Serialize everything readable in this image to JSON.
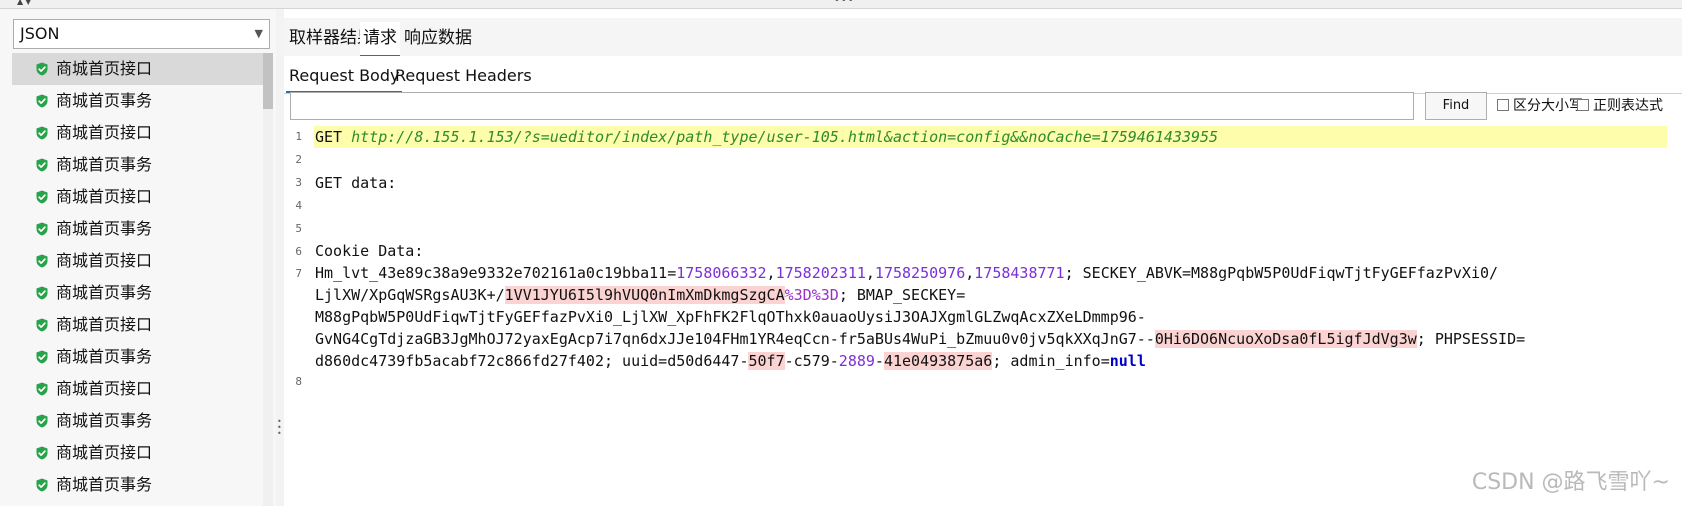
{
  "renderer": {
    "selected": "JSON"
  },
  "sample_list": {
    "items": [
      {
        "label": "商城首页接口",
        "status": "success"
      },
      {
        "label": "商城首页事务",
        "status": "success"
      },
      {
        "label": "商城首页接口",
        "status": "success"
      },
      {
        "label": "商城首页事务",
        "status": "success"
      },
      {
        "label": "商城首页接口",
        "status": "success"
      },
      {
        "label": "商城首页事务",
        "status": "success"
      },
      {
        "label": "商城首页接口",
        "status": "success"
      },
      {
        "label": "商城首页事务",
        "status": "success"
      },
      {
        "label": "商城首页接口",
        "status": "success"
      },
      {
        "label": "商城首页事务",
        "status": "success"
      },
      {
        "label": "商城首页接口",
        "status": "success"
      },
      {
        "label": "商城首页事务",
        "status": "success"
      },
      {
        "label": "商城首页接口",
        "status": "success"
      },
      {
        "label": "商城首页事务",
        "status": "success"
      }
    ]
  },
  "main_tabs": [
    {
      "label": "取样器结果",
      "active": false
    },
    {
      "label": "请求",
      "active": true
    },
    {
      "label": "响应数据",
      "active": false
    }
  ],
  "sub_tabs": [
    {
      "label": "Request Body",
      "active": true
    },
    {
      "label": "Request Headers",
      "active": false
    }
  ],
  "search": {
    "value": "",
    "find_label": "Find",
    "case_sensitive_label": "区分大小写",
    "regex_label": "正则表达式"
  },
  "editor": {
    "line_numbers": [
      "1",
      "2",
      "3",
      "4",
      "5",
      "6",
      "7",
      "8"
    ],
    "line1_method": "GET ",
    "line1_url": "http://8.155.1.153/?s=ueditor/index/path_type/user-105.html&action=config&&noCache=1759461433955",
    "line3": "GET data:",
    "line6": "Cookie Data:",
    "cookie": {
      "l1_a": "Hm_lvt_43e89c38a9e9332e702161a0c19bba11=",
      "l1_n1": "1758066332",
      "l1_n2": "1758202311",
      "l1_n3": "1758250976",
      "l1_n4": "1758438771",
      "l1_b": "; SECKEY_ABVK=M88gPqbW5P0UdFiqwTjtFyGEFfazPvXi0/",
      "l2_a": "LjlXW/XpGqWSRgsAU3K+/",
      "l2_hl": "1VV1JYU6I5l9hVUQ0nImXmDkmgSzgCA",
      "l2_pct": "%3D%3D",
      "l2_b": "; BMAP_SECKEY=",
      "l3": "M88gPqbW5P0UdFiqwTjtFyGEFfazPvXi0_LjlXW_XpFhFK2FlqOThxk0auaoUysiJ3OAJXgmlGLZwqAcxZXeLDmmp96-",
      "l4_a": "GvNG4CgTdjzaGB3JgMhOJ72yaxEgAcp7i7qn6dxJJe104FHm1YR4eqCcn-fr5aBUs4WuPi_bZmuu0v0jv5qkXXqJnG7--",
      "l4_hl": "0Hi6DO6NcuoXoDsa0fL5igfJdVg3w",
      "l4_b": "; PHPSESSID=",
      "l5_a": "d860dc4739fb5acabf72c866fd27f402; uuid=d50d6447-",
      "l5_hl1": "50f7",
      "l5_b": "-c579-",
      "l5_n": "2889",
      "l5_c": "-",
      "l5_hl2": "41e0493875a6",
      "l5_d": "; admin_info=",
      "l5_null": "null"
    }
  },
  "watermark": "CSDN @路飞雪吖~",
  "colors": {
    "accent": "#2d6db5",
    "url_green": "#2e8b2e",
    "number_purple": "#7b2fd8",
    "highlight_pink": "#fbd3d3",
    "current_line": "#fdfdac",
    "success_green": "#2aa24a"
  },
  "icons": {
    "sample_status": "check-shield-icon"
  }
}
